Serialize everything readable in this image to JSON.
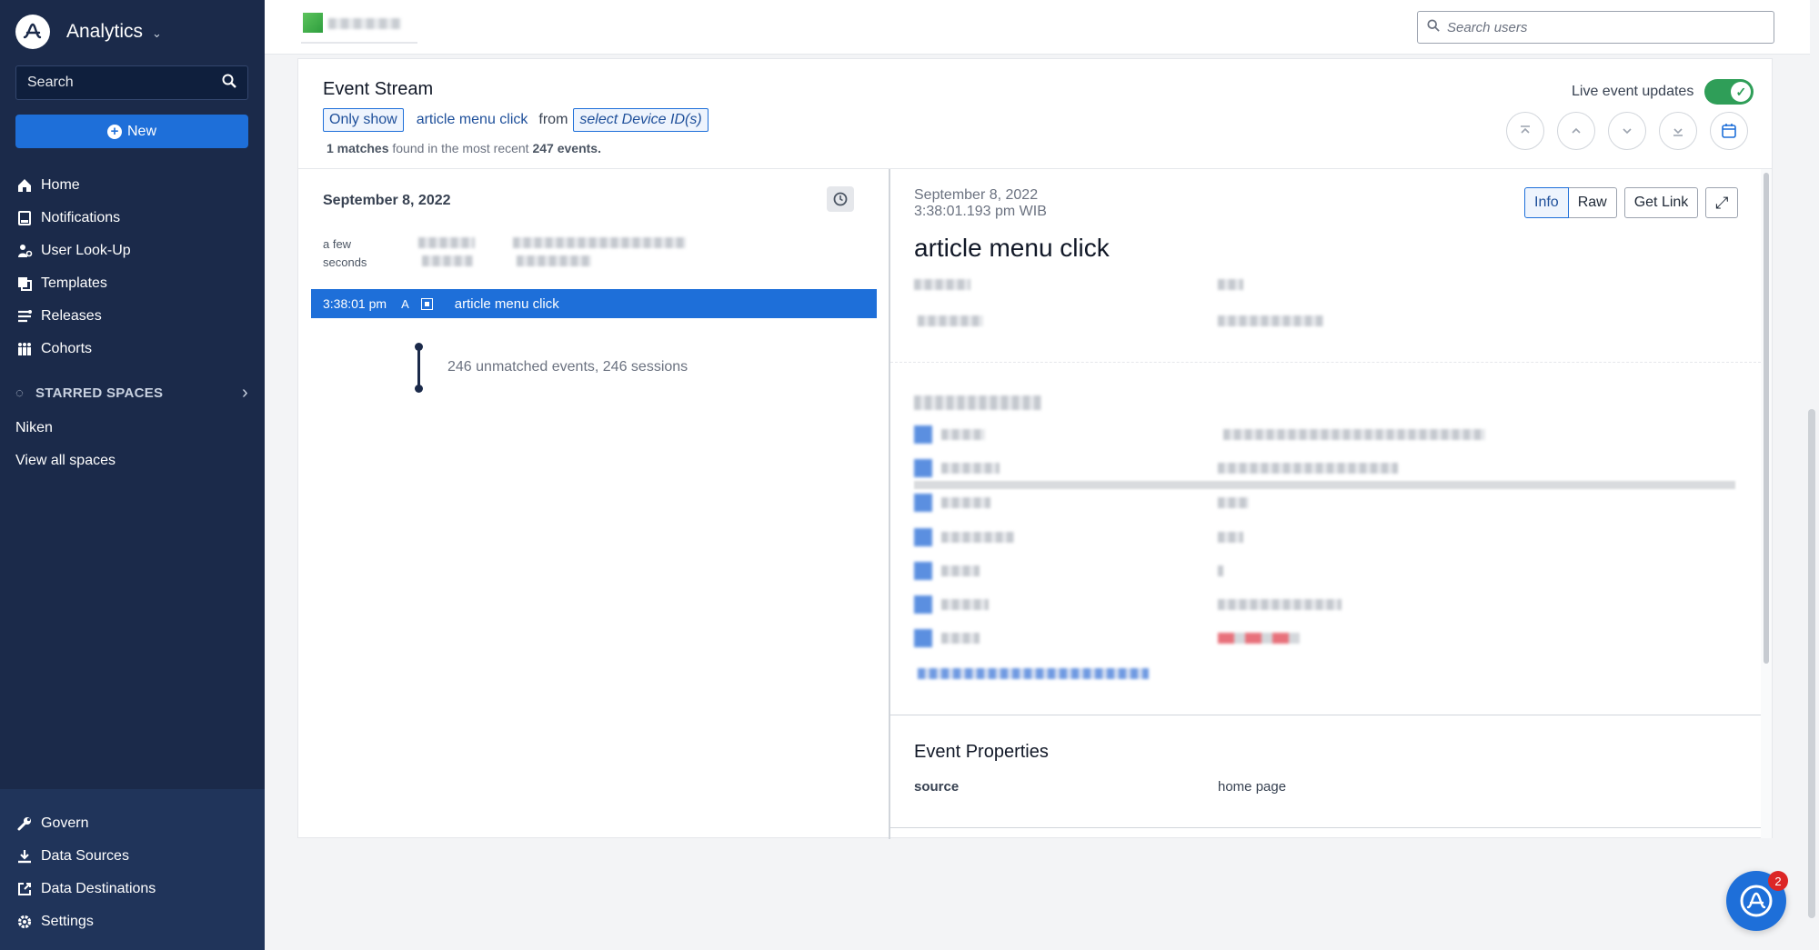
{
  "sidebar": {
    "app_title": "Analytics",
    "search_label": "Search",
    "new_label": "New",
    "nav": [
      {
        "label": "Home",
        "icon": "home-icon"
      },
      {
        "label": "Notifications",
        "icon": "notifications-icon"
      },
      {
        "label": "User Look-Up",
        "icon": "user-lookup-icon"
      },
      {
        "label": "Templates",
        "icon": "templates-icon"
      },
      {
        "label": "Releases",
        "icon": "releases-icon"
      },
      {
        "label": "Cohorts",
        "icon": "cohorts-icon"
      }
    ],
    "starred_label": "STARRED SPACES",
    "spaces": [
      "Niken",
      "View all spaces"
    ],
    "bottom_nav": [
      {
        "label": "Govern",
        "icon": "wrench-icon"
      },
      {
        "label": "Data Sources",
        "icon": "download-icon"
      },
      {
        "label": "Data Destinations",
        "icon": "export-icon"
      },
      {
        "label": "Settings",
        "icon": "gear-icon"
      }
    ]
  },
  "topbar": {
    "user_search_placeholder": "Search users"
  },
  "event_stream": {
    "title": "Event Stream",
    "filter": {
      "only_show": "Only show",
      "event_name": "article menu click",
      "from": "from",
      "device_select": "select Device ID(s)"
    },
    "matches": {
      "count": "1 matches",
      "found_text": "found in the most recent",
      "total": "247 events."
    },
    "live_updates_label": "Live event updates",
    "live_updates_on": true,
    "list": {
      "date": "September 8, 2022",
      "ago_line1": "a few",
      "ago_line2": "seconds",
      "selected_event": {
        "time": "3:38:01 pm",
        "platform": "A",
        "name": "article menu click"
      },
      "unmatched": "246 unmatched events, 246 sessions"
    },
    "detail": {
      "date": "September 8, 2022",
      "time": "3:38:01.193 pm WIB",
      "title": "article menu click",
      "buttons": {
        "info": "Info",
        "raw": "Raw",
        "get_link": "Get Link"
      },
      "properties_title": "Event Properties",
      "properties": [
        {
          "key": "source",
          "value": "home page"
        }
      ]
    }
  },
  "help": {
    "badge": "2"
  },
  "colors": {
    "sidebar": "#1b2a4a",
    "accent": "#1e6fd9",
    "toggle": "#2f9e58",
    "badge": "#dc2626"
  }
}
